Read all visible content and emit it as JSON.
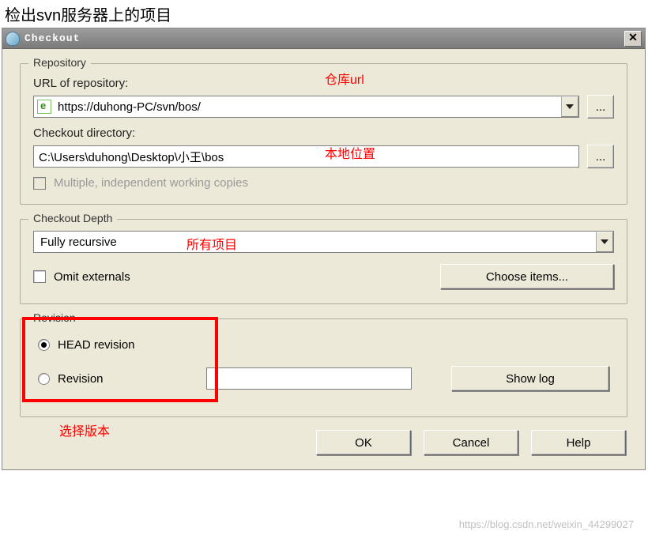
{
  "page_heading": "检出svn服务器上的项目",
  "window": {
    "title": "Checkout",
    "close_symbol": "✕"
  },
  "repository": {
    "legend": "Repository",
    "url_label": "URL of repository:",
    "url_value": "https://duhong-PC/svn/bos/",
    "dir_label": "Checkout directory:",
    "dir_value": "C:\\Users\\duhong\\Desktop\\小王\\bos",
    "browse_label": "...",
    "multi_label": "Multiple, independent working copies"
  },
  "depth": {
    "legend": "Checkout Depth",
    "value": "Fully recursive",
    "omit_label": "Omit externals",
    "choose_label": "Choose items..."
  },
  "revision": {
    "legend": "Revision",
    "head_label": "HEAD revision",
    "rev_label": "Revision",
    "showlog_label": "Show log"
  },
  "buttons": {
    "ok": "OK",
    "cancel": "Cancel",
    "help": "Help"
  },
  "annotations": {
    "url": "仓库url",
    "dir": "本地位置",
    "depth": "所有项目",
    "revision": "选择版本"
  },
  "watermark": "https://blog.csdn.net/weixin_44299027"
}
